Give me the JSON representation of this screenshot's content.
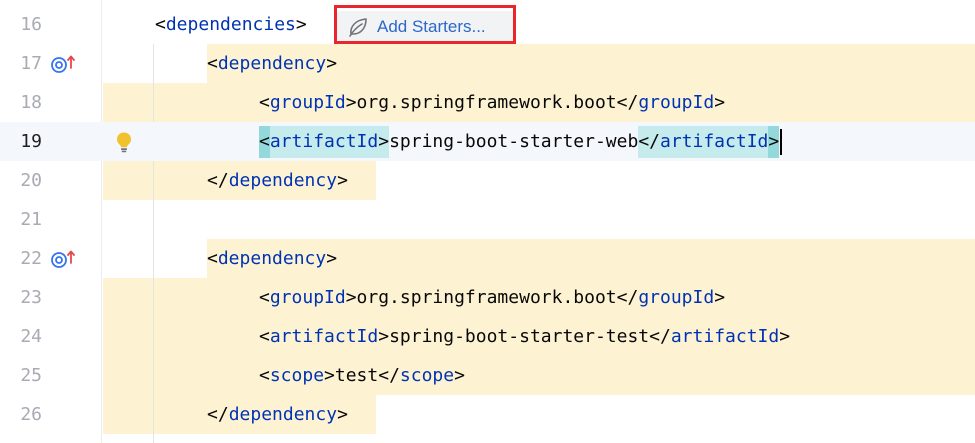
{
  "editor": {
    "inlay_hint": {
      "label": "Add Starters...",
      "icon": "spring-leaf-icon"
    },
    "current_line": "19",
    "lines": [
      {
        "number": "16",
        "tokens": [
          {
            "t": "<",
            "k": "txt"
          },
          {
            "t": "dependencies",
            "k": "tag"
          },
          {
            "t": ">",
            "k": "txt"
          }
        ]
      },
      {
        "number": "17",
        "gutter_icon": "override-method-icon",
        "tokens": [
          {
            "t": "<",
            "k": "txt"
          },
          {
            "t": "dependency",
            "k": "tag"
          },
          {
            "t": ">",
            "k": "txt"
          }
        ]
      },
      {
        "number": "18",
        "tokens": [
          {
            "t": "<",
            "k": "txt"
          },
          {
            "t": "groupId",
            "k": "tag"
          },
          {
            "t": ">",
            "k": "txt"
          },
          {
            "t": "org.springframework.boot",
            "k": "txt"
          },
          {
            "t": "</",
            "k": "txt"
          },
          {
            "t": "groupId",
            "k": "tag"
          },
          {
            "t": ">",
            "k": "txt"
          }
        ]
      },
      {
        "number": "19",
        "gutter_icon": "lightbulb-icon",
        "tokens": [
          {
            "t": "<",
            "k": "txt"
          },
          {
            "t": "artifactId",
            "k": "tag"
          },
          {
            "t": ">",
            "k": "txt"
          },
          {
            "t": "spring-boot-starter-web",
            "k": "txt"
          },
          {
            "t": "</",
            "k": "txt"
          },
          {
            "t": "artifactId",
            "k": "tag"
          },
          {
            "t": ">",
            "k": "txt"
          }
        ]
      },
      {
        "number": "20",
        "tokens": [
          {
            "t": "</",
            "k": "txt"
          },
          {
            "t": "dependency",
            "k": "tag"
          },
          {
            "t": ">",
            "k": "txt"
          }
        ]
      },
      {
        "number": "21",
        "tokens": []
      },
      {
        "number": "22",
        "gutter_icon": "override-method-icon",
        "tokens": [
          {
            "t": "<",
            "k": "txt"
          },
          {
            "t": "dependency",
            "k": "tag"
          },
          {
            "t": ">",
            "k": "txt"
          }
        ]
      },
      {
        "number": "23",
        "tokens": [
          {
            "t": "<",
            "k": "txt"
          },
          {
            "t": "groupId",
            "k": "tag"
          },
          {
            "t": ">",
            "k": "txt"
          },
          {
            "t": "org.springframework.boot",
            "k": "txt"
          },
          {
            "t": "</",
            "k": "txt"
          },
          {
            "t": "groupId",
            "k": "tag"
          },
          {
            "t": ">",
            "k": "txt"
          }
        ]
      },
      {
        "number": "24",
        "tokens": [
          {
            "t": "<",
            "k": "txt"
          },
          {
            "t": "artifactId",
            "k": "tag"
          },
          {
            "t": ">",
            "k": "txt"
          },
          {
            "t": "spring-boot-starter-test",
            "k": "txt"
          },
          {
            "t": "</",
            "k": "txt"
          },
          {
            "t": "artifactId",
            "k": "tag"
          },
          {
            "t": ">",
            "k": "txt"
          }
        ]
      },
      {
        "number": "25",
        "tokens": [
          {
            "t": "<",
            "k": "txt"
          },
          {
            "t": "scope",
            "k": "tag"
          },
          {
            "t": ">",
            "k": "txt"
          },
          {
            "t": "test",
            "k": "txt"
          },
          {
            "t": "</",
            "k": "txt"
          },
          {
            "t": "scope",
            "k": "tag"
          },
          {
            "t": ">",
            "k": "txt"
          }
        ]
      },
      {
        "number": "26",
        "tokens": [
          {
            "t": "</",
            "k": "txt"
          },
          {
            "t": "dependency",
            "k": "tag"
          },
          {
            "t": ">",
            "k": "txt"
          }
        ]
      }
    ]
  },
  "colors": {
    "tag": "#0033b3",
    "text": "#080808",
    "line_number": "#a8abb3",
    "highlight_band": "#fdf3d3",
    "tag_match": "#c5ebed",
    "callout_border": "#e8262b",
    "inlay_text": "#2b67c9"
  }
}
